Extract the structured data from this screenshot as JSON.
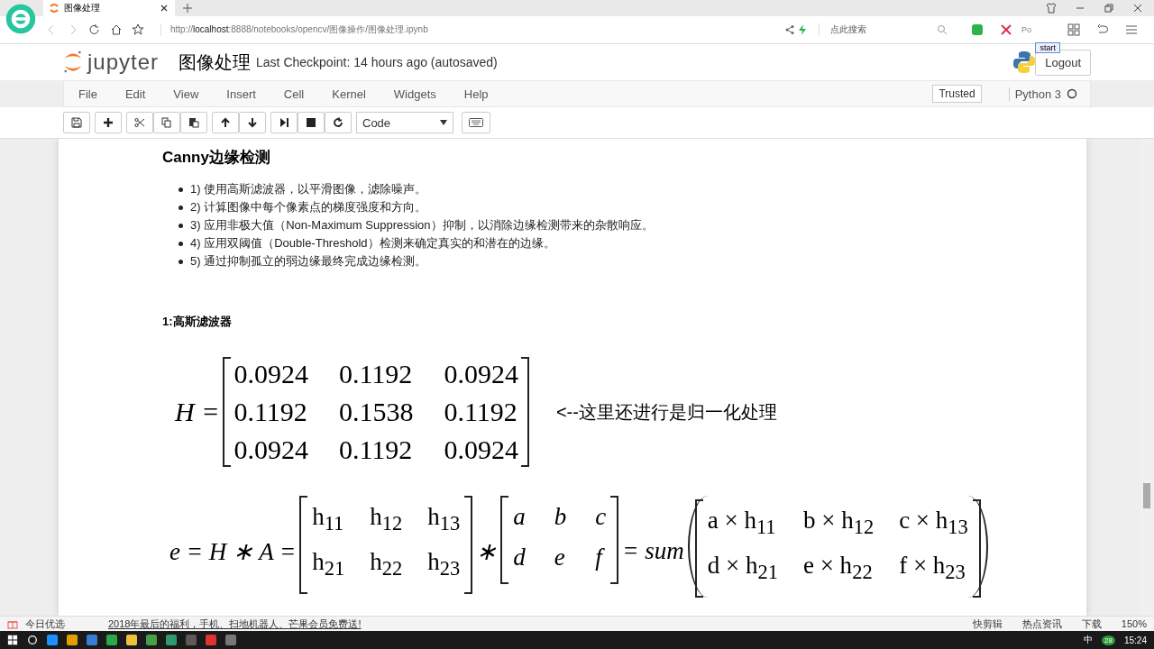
{
  "browser": {
    "tab_title": "图像处理",
    "url": "http://**localhost**:8888/notebooks/opencv/图像操作/图像处理.ipynb",
    "search_placeholder": "点此搜索",
    "extension_label": "Po",
    "tooltip": "start"
  },
  "header": {
    "logo_text": "jupyter",
    "notebook_name": "图像处理",
    "checkpoint": "Last Checkpoint: 14 hours ago (autosaved)",
    "logout": "Logout"
  },
  "menu": [
    "File",
    "Edit",
    "View",
    "Insert",
    "Cell",
    "Kernel",
    "Widgets",
    "Help"
  ],
  "trusted": "Trusted",
  "kernel": "Python 3",
  "toolbar": {
    "cell_type": "Code"
  },
  "notebook": {
    "heading": "Canny边缘检测",
    "steps": [
      "1) 使用高斯滤波器，以平滑图像，滤除噪声。",
      "2) 计算图像中每个像素点的梯度强度和方向。",
      "3) 应用非极大值（Non-Maximum Suppression）抑制，以消除边缘检测带来的杂散响应。",
      "4) 应用双阈值（Double-Threshold）检测来确定真实的和潜在的边缘。",
      "5) 通过抑制孤立的弱边缘最终完成边缘检测。"
    ],
    "subheading": "1:高斯滤波器",
    "eq1": {
      "lhs": "H =",
      "matrix": [
        [
          "0.0924",
          "0.1192",
          "0.0924"
        ],
        [
          "0.1192",
          "0.1538",
          "0.1192"
        ],
        [
          "0.0924",
          "0.1192",
          "0.0924"
        ]
      ],
      "note": "<--这里还进行是归一化处理"
    },
    "eq2": {
      "lhs": "e = H ∗ A =",
      "h": [
        [
          "h$_{11}$",
          "h$_{12}$",
          "h$_{13}$"
        ],
        [
          "h$_{21}$",
          "h$_{22}$",
          "h$_{23}$"
        ]
      ],
      "op": "∗",
      "a": [
        [
          "a",
          "b",
          "c"
        ],
        [
          "d",
          "e",
          "f"
        ]
      ],
      "eq": "= sum",
      "prod": [
        [
          "a × h$_{11}$",
          "b × h$_{12}$",
          "c × h$_{13}$"
        ],
        [
          "d × h$_{21}$",
          "e × h$_{22}$",
          "f × h$_{23}$"
        ]
      ]
    }
  },
  "status_bar": {
    "left": "今日优选",
    "news": "2018年最后的福利，手机、扫地机器人、芒果会员免费送!",
    "items": [
      "快剪辑",
      "热点资讯",
      "下载"
    ],
    "zoom": "150%"
  },
  "taskbar": {
    "badge": "28",
    "ime": "中",
    "time": "15:24"
  }
}
